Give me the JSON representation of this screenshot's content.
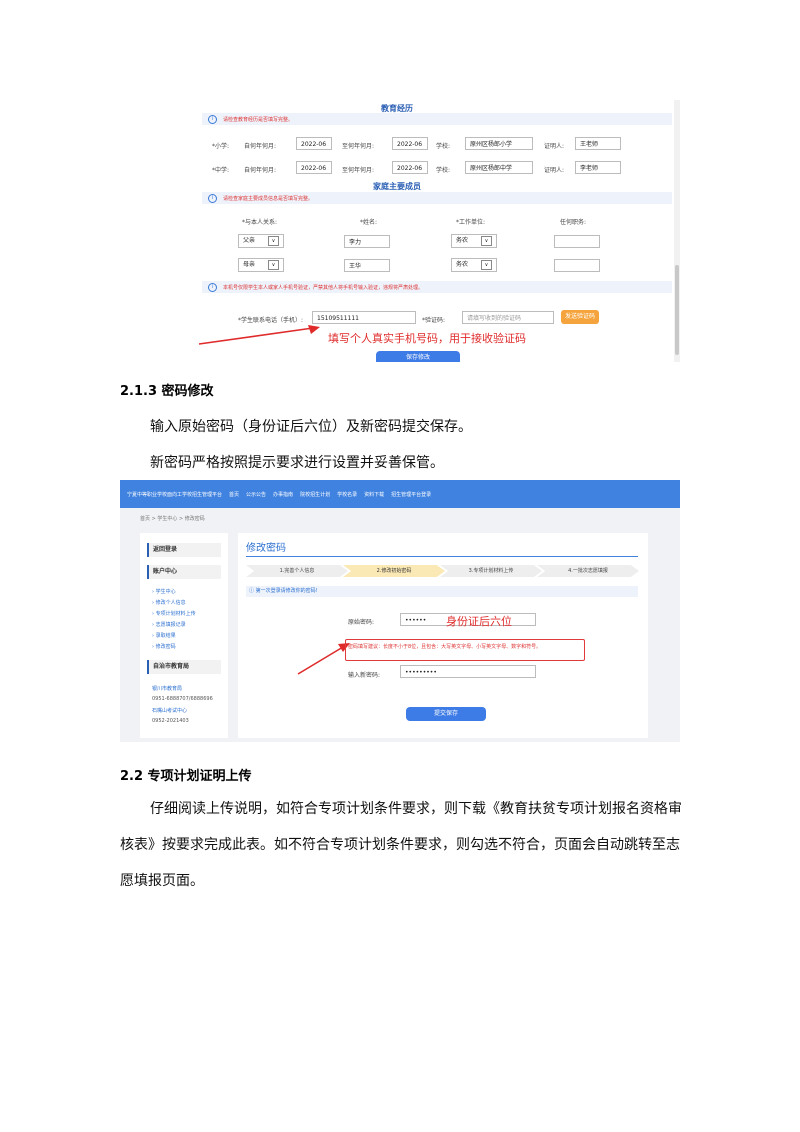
{
  "shot1": {
    "education_title": "教育经历",
    "education_notice": "请检查教育经历是否填写完整。",
    "education_rows": [
      {
        "level": "*小学:",
        "from_label": "自何年何月:",
        "from": "2022-06",
        "to_label": "至何年何月:",
        "to": "2022-06",
        "school_label": "学校:",
        "school": "原州区杨郎小学",
        "witness_label": "证明人:",
        "witness": "王老师"
      },
      {
        "level": "*中学:",
        "from_label": "自何年何月:",
        "from": "2022-06",
        "to_label": "至何年何月:",
        "to": "2022-06",
        "school_label": "学校:",
        "school": "原州区杨郎中学",
        "witness_label": "证明人:",
        "witness": "李老师"
      }
    ],
    "family_title": "家庭主要成员",
    "family_notice": "请检查家庭主要成员信息是否填写完整。",
    "family_headers": [
      "*与本人关系:",
      "*姓名:",
      "*工作单位:",
      "任何职务:"
    ],
    "family_rows": [
      {
        "relation": "父亲",
        "name": "李力",
        "work": "务农",
        "post": ""
      },
      {
        "relation": "母亲",
        "name": "王华",
        "work": "务农",
        "post": ""
      }
    ],
    "phone_notice": "本机号仅限学生本人或家人手机号验证，严禁其他人将手机号输入验证，违规将严肃处理。",
    "phone_label": "*学生联系电话（手机）:",
    "phone_value": "15109511111",
    "code_label": "*验证码:",
    "code_placeholder": "请填写收到的验证码",
    "send_code_button": "发送验证码",
    "save_button": "保存修改",
    "annotation": "填写个人真实手机号码，用于接收验证码"
  },
  "doc": {
    "section_213": "2.1.3  密码修改",
    "para1": "输入原始密码（身份证后六位）及新密码提交保存。",
    "para2": "新密码严格按照提示要求进行设置并妥善保管。",
    "section_22": "2.2  专项计划证明上传",
    "para3_line1": "仔细阅读上传说明，如符合专项计划条件要求，则下载《教育扶贫专项计划报名资格审",
    "para3_line2": "核表》按要求完成此表。如不符合专项计划条件要求，则勾选不符合，页面会自动跳转至志",
    "para3_line3": "愿填报页面。"
  },
  "shot2": {
    "nav": [
      "宁夏中等职业学校面向工学校招生管理平台",
      "首页",
      "公示公告",
      "办事指南",
      "院校招生计划",
      "学校名录",
      "资料下载",
      "招生管理平台登录"
    ],
    "breadcrumb": "首页 > 学生中心 > 修改密码",
    "side_header1": "返回登录",
    "side_header2": "账户中心",
    "side_items": [
      "学生中心",
      "修改个人信息",
      "专项计划材料上传",
      "志愿填报记录",
      "录取结果",
      "修改密码"
    ],
    "side_header3": "自治市教育局",
    "side_contacts": [
      "银川市教育局",
      "0951-6888707/6888696",
      "石嘴山考试中心",
      "0952-2021403"
    ],
    "page_title": "修改密码",
    "steps": [
      "1.完善个人信息",
      "2.修改初始密码",
      "3.专项计划材料上传",
      "4.一批次志愿填报"
    ],
    "tip": "第一次登录请修改你的密码!",
    "old_pwd_label": "原始密码:",
    "old_pwd_value": "••••••",
    "old_pwd_annotation": "身份证后六位",
    "rule_text": "密码填写建议：长度不小于8位，且包含：大写英文字母、小写英文字母、数字和符号。",
    "new_pwd_label": "输入新密码:",
    "new_pwd_value": "•••••••••",
    "submit_button": "提交保存"
  }
}
